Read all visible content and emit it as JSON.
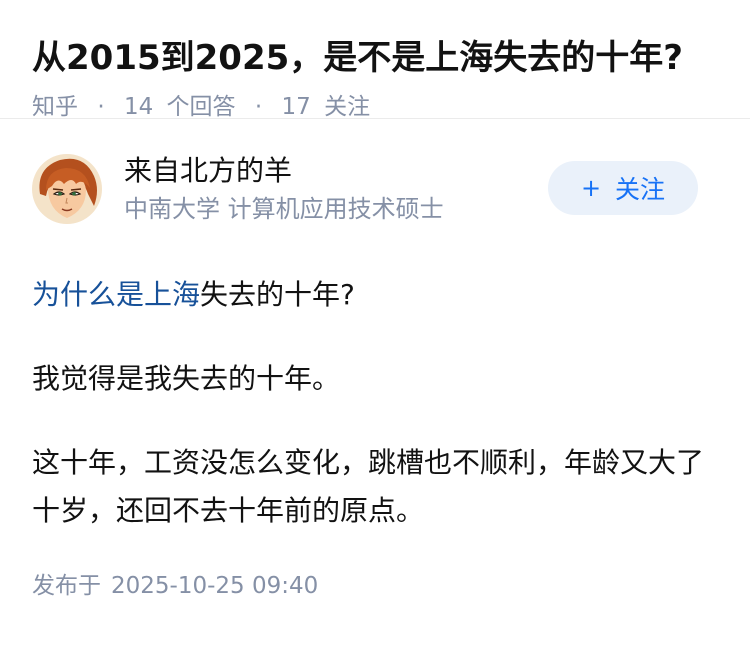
{
  "question": {
    "title": "从2015到2025，是不是上海失去的十年?",
    "source": "知乎",
    "separator": "·",
    "answer_count": "14",
    "answer_label": "个回答",
    "follower_count": "17",
    "follower_label": "关注"
  },
  "answer": {
    "author": {
      "name": "来自北方的羊",
      "bio": "中南大学 计算机应用技术硕士",
      "avatar_icon": "cartoon-avatar-icon"
    },
    "follow_button": {
      "icon": "plus-icon",
      "plus": "+",
      "label": "关注"
    },
    "content": {
      "p1_link": "为什么是上海",
      "p1_rest": "失去的十年?",
      "p2": "我觉得是我失去的十年。",
      "p3": "这十年，工资没怎么变化，跳槽也不顺利，年龄又大了十岁，还回不去十年前的原点。"
    },
    "publish": {
      "label": "发布于",
      "time": "2025-10-25 09:40"
    }
  },
  "colors": {
    "link": "#175199",
    "meta_gray": "#8590a6",
    "follow_bg": "#eaf1fa",
    "follow_text": "#1772f6"
  }
}
